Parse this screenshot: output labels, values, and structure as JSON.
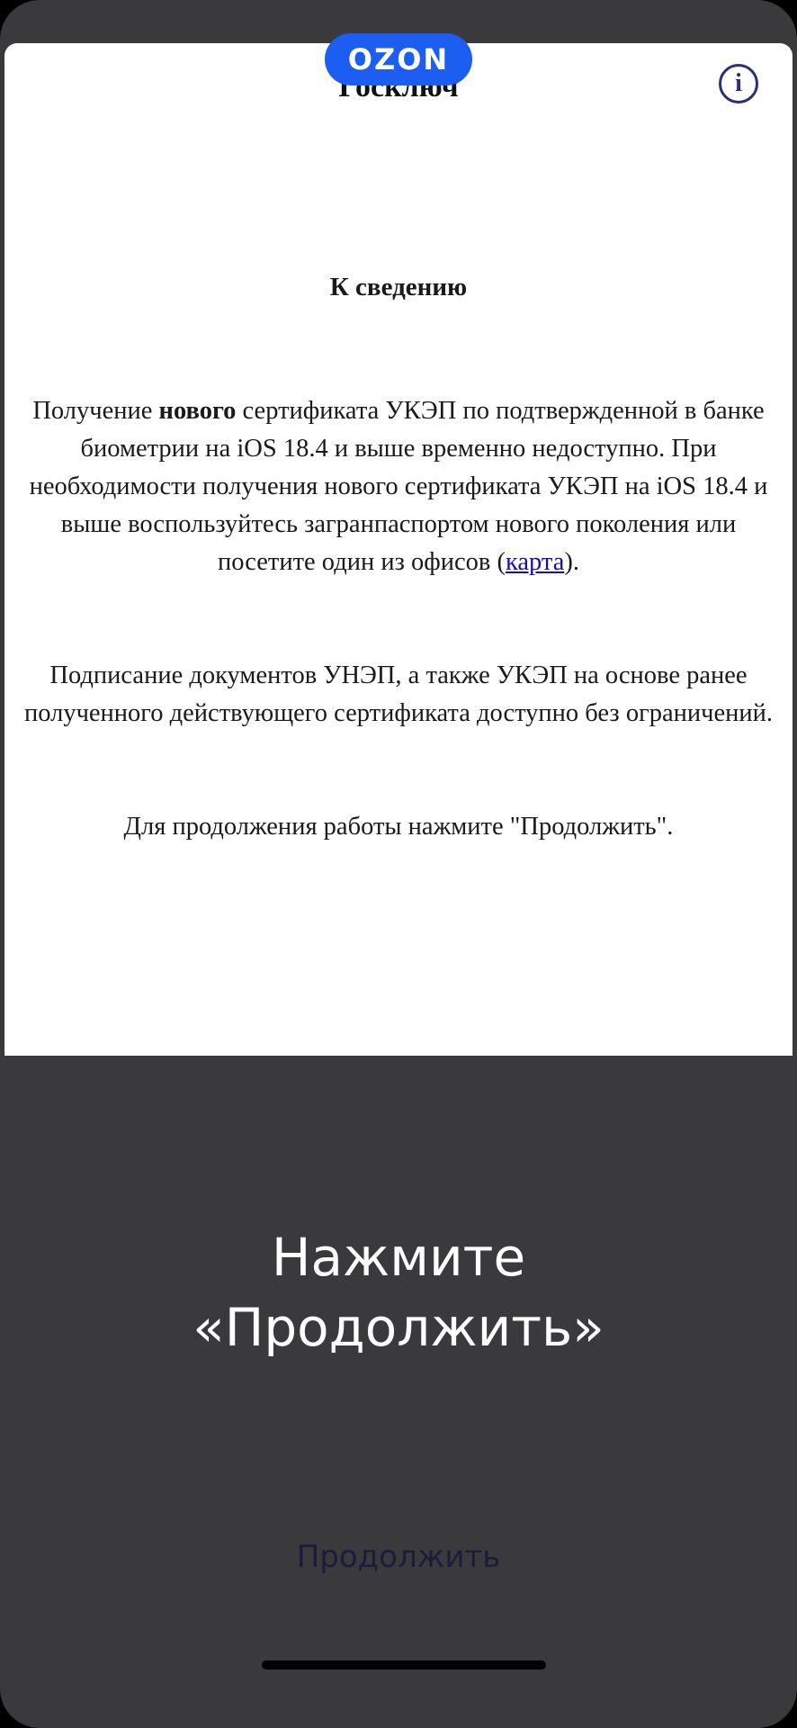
{
  "app": {
    "title": "Госключ"
  },
  "badge": {
    "label": "OZON",
    "color": "#1d5ef2"
  },
  "info_icon": {
    "glyph": "i",
    "name": "info-icon"
  },
  "notice": {
    "heading": "К сведению",
    "para1_prefix": "Получение ",
    "para1_bold": "нового",
    "para1_mid": " сертификата УКЭП по подтвержденной в банке биометрии на iOS 18.4 и выше временно недоступно. При необходимости получения нового сертификата УКЭП на iOS 18.4 и выше воспользуйтесь загранпаспортом нового поколения или посетите один из офисов (",
    "para1_link": "карта",
    "para1_suffix": ").",
    "para2": "Подписание документов УНЭП, а также УКЭП на основе ранее полученного действующего сертификата доступно без ограничений.",
    "para3": "Для продолжения работы нажмите \"Продолжить\"."
  },
  "overlay": {
    "line1": "Нажмите",
    "line2": "«Продолжить»"
  },
  "actions": {
    "continue_label": "Продолжить"
  }
}
